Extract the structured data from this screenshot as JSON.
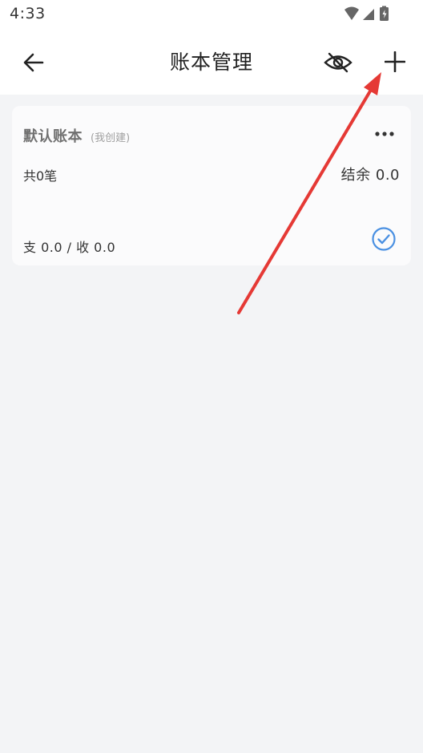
{
  "status_bar": {
    "time": "4:33",
    "icons": [
      "wifi-icon",
      "cellular-signal-icon",
      "battery-charging-icon"
    ]
  },
  "header": {
    "title": "账本管理",
    "back_icon": "arrow-left-icon",
    "visibility_icon": "eye-off-icon",
    "add_icon": "plus-icon"
  },
  "books": [
    {
      "name": "默认账本",
      "tag": "(我创建)",
      "count_text": "共0笔",
      "balance_text": "结余 0.0",
      "summary_text": "支 0.0 / 收 0.0",
      "selected": true
    }
  ],
  "annotation": {
    "arrow_color": "#e53935",
    "points_to": "add-button"
  },
  "colors": {
    "background": "#f3f4f6",
    "card": "#fbfbfc",
    "accent": "#4a90e2"
  }
}
